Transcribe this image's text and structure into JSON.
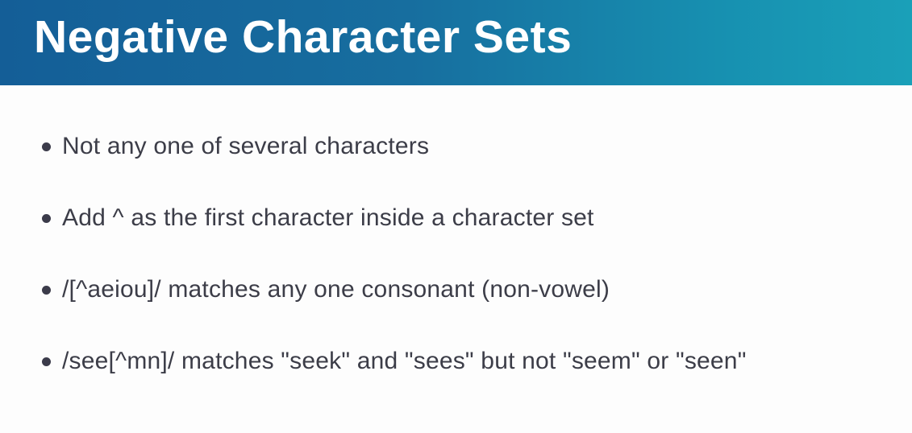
{
  "slide": {
    "title": "Negative Character Sets",
    "bullets": [
      "Not any one of several characters",
      "Add ^ as the first character inside a character set",
      "/[^aeiou]/ matches any one consonant (non-vowel)",
      "/see[^mn]/ matches \"seek\" and \"sees\" but not \"seem\" or \"seen\""
    ]
  },
  "colors": {
    "header_start": "#145e97",
    "header_end": "#1aa0b8",
    "title_text": "#ffffff",
    "body_text": "#3c3d48",
    "background": "#fdfdfd"
  }
}
